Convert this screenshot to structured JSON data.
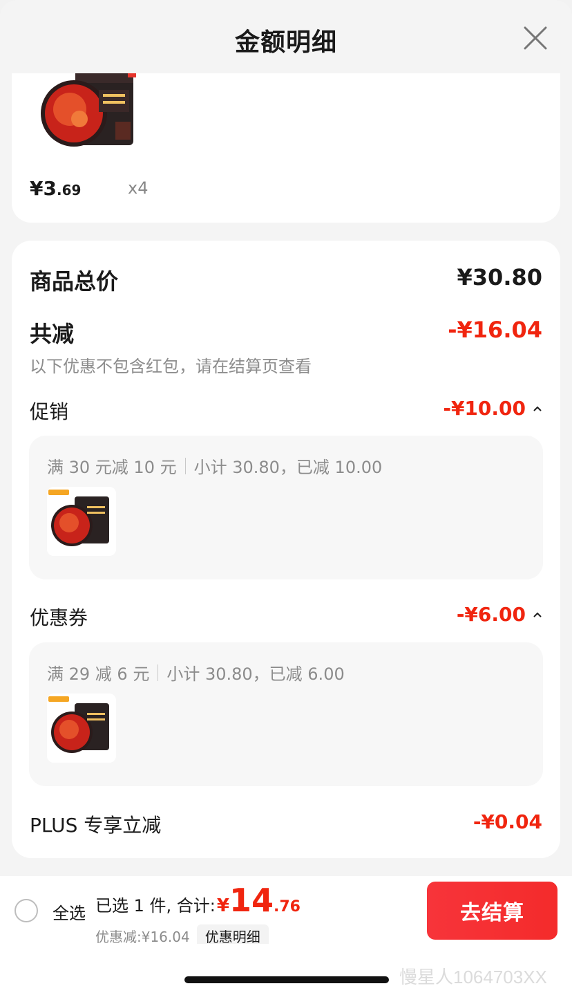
{
  "header": {
    "title": "金额明细"
  },
  "product": {
    "price_int": "¥3",
    "price_dec": ".69",
    "quantity": "x4"
  },
  "summary": {
    "total_label": "商品总价",
    "total_value": "¥30.80",
    "reduce_label": "共减",
    "reduce_value": "-¥16.04",
    "reduce_note": "以下优惠不包含红包，请在结算页查看"
  },
  "promotion": {
    "label": "促销",
    "value": "-¥10.00",
    "rule": "满 30 元减 10 元",
    "subtotal": "小计 30.80，已减 10.00"
  },
  "coupon": {
    "label": "优惠券",
    "value": "-¥6.00",
    "rule": "满 29 减 6 元",
    "subtotal": "小计 30.80，已减 6.00"
  },
  "plus": {
    "label": "PLUS 专享立减",
    "value": "-¥0.04"
  },
  "bottom_bar": {
    "select_all": "全选",
    "selected_text": "已选 1 件, 合计:",
    "total_yen": "¥",
    "total_int": "14",
    "total_dec": ".76",
    "saving_text": "优惠减:¥16.04",
    "detail_tag": "优惠明细",
    "checkout": "去结算"
  },
  "watermark": "慢星人1064703XX",
  "colors": {
    "accent_red": "#f0250f",
    "checkout_bg": "#f42b2b"
  }
}
